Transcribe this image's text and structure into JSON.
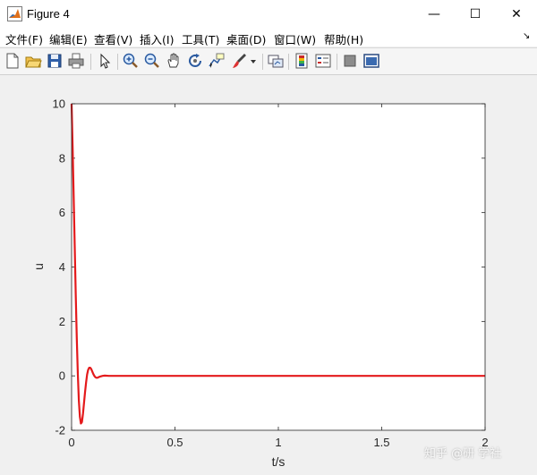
{
  "window": {
    "title": "Figure 4",
    "minimize_glyph": "—",
    "maximize_glyph": "☐",
    "close_glyph": "✕"
  },
  "menu": {
    "items": [
      {
        "label": "文件(F)"
      },
      {
        "label": "编辑(E)"
      },
      {
        "label": "查看(V)"
      },
      {
        "label": "插入(I)"
      },
      {
        "label": "工具(T)"
      },
      {
        "label": "桌面(D)"
      },
      {
        "label": "窗口(W)"
      },
      {
        "label": "帮助(H)"
      }
    ],
    "overflow_glyph": "↘"
  },
  "toolbar": {
    "icons": [
      "new-figure-icon",
      "open-file-icon",
      "save-icon",
      "print-icon",
      "pointer-icon",
      "zoom-in-icon",
      "zoom-out-icon",
      "pan-hand-icon",
      "rotate-3d-icon",
      "data-cursor-icon",
      "brush-icon",
      "link-plot-icon",
      "insert-colorbar-icon",
      "insert-legend-icon",
      "hide-plot-tools-icon",
      "show-plot-tools-icon"
    ]
  },
  "chart_data": {
    "type": "line",
    "xlabel": "t/s",
    "ylabel": "u",
    "xlim": [
      0,
      2
    ],
    "ylim": [
      -2,
      10
    ],
    "xticks": [
      0,
      0.5,
      1,
      1.5,
      2
    ],
    "xtick_labels": [
      "0",
      "0.5",
      "1",
      "1.5",
      "2"
    ],
    "yticks": [
      -2,
      0,
      2,
      4,
      6,
      8,
      10
    ],
    "ytick_labels": [
      "-2",
      "0",
      "2",
      "4",
      "6",
      "8",
      "10"
    ],
    "grid": false,
    "line_color": "#e41a1c",
    "series": [
      {
        "x": [
          0,
          0.005,
          0.01,
          0.015,
          0.02,
          0.025,
          0.03,
          0.035,
          0.04,
          0.045,
          0.05,
          0.055,
          0.06,
          0.065,
          0.07,
          0.075,
          0.08,
          0.085,
          0.09,
          0.095,
          0.1,
          0.105,
          0.11,
          0.115,
          0.12,
          0.125,
          0.13,
          0.14,
          0.15,
          0.16,
          0.18,
          0.2,
          0.25,
          0.3,
          0.5,
          1.0,
          1.5,
          2.0
        ],
        "y": [
          10,
          8.4,
          6.6,
          4.8,
          3.0,
          1.4,
          0.1,
          -0.9,
          -1.5,
          -1.75,
          -1.7,
          -1.4,
          -1.0,
          -0.6,
          -0.25,
          0.05,
          0.22,
          0.3,
          0.3,
          0.25,
          0.16,
          0.07,
          0.0,
          -0.05,
          -0.07,
          -0.07,
          -0.05,
          -0.02,
          0.0,
          0.01,
          0.0,
          0.0,
          0.0,
          0.0,
          0.0,
          0.0,
          0.0,
          0.0
        ]
      }
    ]
  },
  "watermark": "知乎 @研 学社"
}
